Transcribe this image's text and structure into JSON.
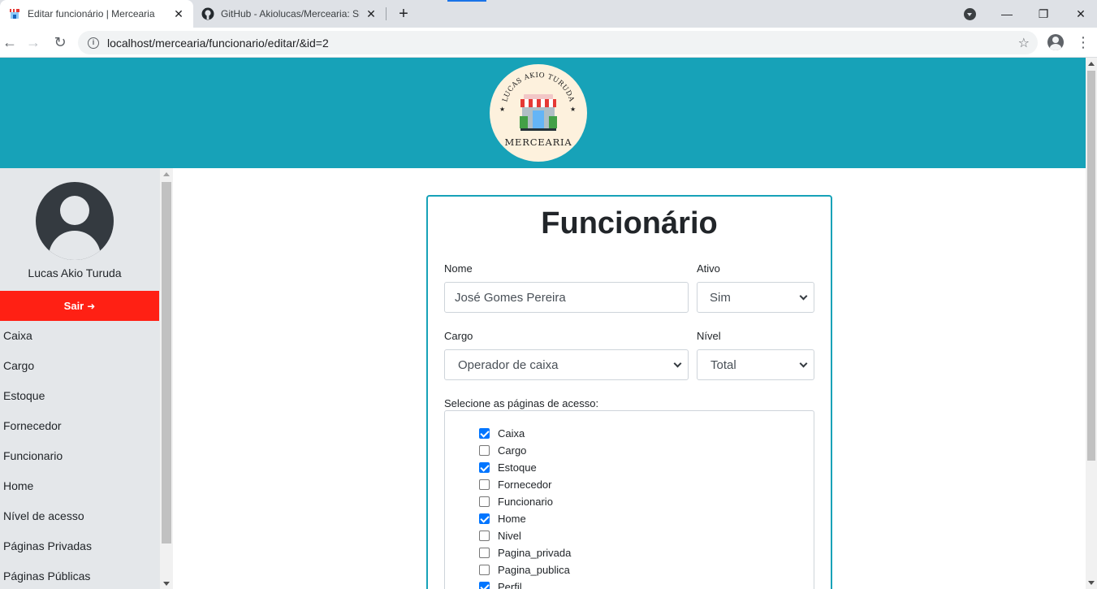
{
  "browser": {
    "tabs": [
      {
        "title": "Editar funcionário | Mercearia",
        "favicon": "store-icon",
        "active": true
      },
      {
        "title": "GitHub - Akiolucas/Mercearia: Si",
        "favicon": "github-icon",
        "active": false
      }
    ],
    "new_tab_label": "+",
    "url": "localhost/mercearia/funcionario/editar/&id=2",
    "window_controls": {
      "minimize": "—",
      "restore": "❐",
      "close": "✕"
    }
  },
  "header": {
    "logo": {
      "top_text": "LUCAS AKIO TURUDA",
      "bottom_text": "MERCEARIA"
    },
    "color": "#17a2b8"
  },
  "sidebar": {
    "user_name": "Lucas Akio Turuda",
    "logout_label": "Sair",
    "logout_color": "#ff2014",
    "items": [
      "Caixa",
      "Cargo",
      "Estoque",
      "Fornecedor",
      "Funcionario",
      "Home",
      "Nível de acesso",
      "Páginas Privadas",
      "Páginas Públicas"
    ]
  },
  "form": {
    "title": "Funcionário",
    "nome": {
      "label": "Nome",
      "value": "José Gomes Pereira"
    },
    "ativo": {
      "label": "Ativo",
      "value": "Sim"
    },
    "cargo": {
      "label": "Cargo",
      "value": "Operador de caixa"
    },
    "nivel": {
      "label": "Nível",
      "value": "Total"
    },
    "pages_label": "Selecione as páginas de acesso:",
    "pages": [
      {
        "label": "Caixa",
        "checked": true
      },
      {
        "label": "Cargo",
        "checked": false
      },
      {
        "label": "Estoque",
        "checked": true
      },
      {
        "label": "Fornecedor",
        "checked": false
      },
      {
        "label": "Funcionario",
        "checked": false
      },
      {
        "label": "Home",
        "checked": true
      },
      {
        "label": "Nivel",
        "checked": false
      },
      {
        "label": "Pagina_privada",
        "checked": false
      },
      {
        "label": "Pagina_publica",
        "checked": false
      },
      {
        "label": "Perfil",
        "checked": true
      }
    ]
  }
}
